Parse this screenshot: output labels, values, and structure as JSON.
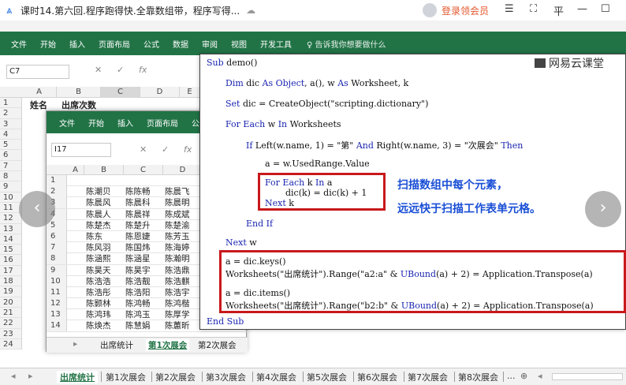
{
  "window": {
    "title": "课时14.第六回.程序跑得快.全靠数组带，程序写得...",
    "vip_label": "登录领会员",
    "ctl_list": "☰",
    "ctl_expand": "⛶",
    "ctl_pin": "平",
    "ctl_min": "—",
    "ctl_max": "☐"
  },
  "ribbon": {
    "tabs": [
      "文件",
      "开始",
      "插入",
      "页面布局",
      "公式",
      "数据",
      "审阅",
      "视图",
      "开发工具"
    ],
    "tell": "♀ 告诉我你想要做什么"
  },
  "outer_sheet": {
    "namebox": "C7",
    "fx": "fx",
    "cols": [
      "A",
      "B",
      "C",
      "D",
      "E"
    ],
    "a1": "姓名",
    "b1": "出席次数",
    "rows": [
      "1",
      "2",
      "3",
      "4",
      "5",
      "6",
      "7",
      "8",
      "9",
      "10",
      "11",
      "12",
      "13",
      "14",
      "15",
      "16",
      "17",
      "18",
      "19",
      "20",
      "21",
      "22",
      "23",
      "24"
    ],
    "tabs": [
      "出席统计",
      "第1次展会",
      "第2次展会",
      "第3次展会",
      "第4次展会",
      "第5次展会",
      "第6次展会",
      "第7次展会",
      "第8次展会",
      "..."
    ]
  },
  "inner_sheet": {
    "ribbon": [
      "文件",
      "开始",
      "插入",
      "页面布局",
      "公"
    ],
    "namebox": "I17",
    "cols": [
      "A",
      "B",
      "C",
      "D"
    ],
    "rows": [
      {
        "n": "1",
        "b": "",
        "c": "",
        "d": ""
      },
      {
        "n": "2",
        "b": "陈潮贝",
        "c": "陈陈畅",
        "d": "陈晨飞"
      },
      {
        "n": "3",
        "b": "陈晨风",
        "c": "陈晨科",
        "d": "陈晨明"
      },
      {
        "n": "4",
        "b": "陈晨人",
        "c": "陈晨祥",
        "d": "陈成斌"
      },
      {
        "n": "5",
        "b": "陈楚杰",
        "c": "陈楚升",
        "d": "陈楚渝"
      },
      {
        "n": "6",
        "b": "陈东",
        "c": "陈恩婕",
        "d": "陈芳玉"
      },
      {
        "n": "7",
        "b": "陈风羽",
        "c": "陈国炜",
        "d": "陈海婷"
      },
      {
        "n": "8",
        "b": "陈涵熙",
        "c": "陈涵星",
        "d": "陈瀚明"
      },
      {
        "n": "9",
        "b": "陈昊天",
        "c": "陈昊宇",
        "d": "陈浩鼎"
      },
      {
        "n": "10",
        "b": "陈浩浩",
        "c": "陈浩靓",
        "d": "陈浩麒"
      },
      {
        "n": "11",
        "b": "陈浩彤",
        "c": "陈浩阳",
        "d": "陈浩宇"
      },
      {
        "n": "12",
        "b": "陈颢林",
        "c": "陈鸿畅",
        "d": "陈鸿楷"
      },
      {
        "n": "13",
        "b": "陈鸿玮",
        "c": "陈鸿玉",
        "d": "陈厚学"
      },
      {
        "n": "14",
        "b": "陈焕杰",
        "c": "陈慧娟",
        "d": "陈蕙昕"
      }
    ],
    "tabs": [
      "出席统计",
      "第1次展会",
      "第2次展会"
    ]
  },
  "code": {
    "l1": "Sub demo()",
    "l2": "Dim dic As Object, a(), w As Worksheet, k",
    "l3": "Set dic = CreateObject(\"scripting.dictionary\")",
    "l4": "For Each w In Worksheets",
    "l5": "If Left(w.name, 1) = \"第\" And Right(w.name, 3) = \"次展会\" Then",
    "l6": "a = w.UsedRange.Value",
    "l7": "For Each k In a",
    "l8": "dic(k) = dic(k) + 1",
    "l9": "Next k",
    "l10": "End If",
    "l11": "Next w",
    "l12": "a = dic.keys()",
    "l13": "Worksheets(\"出席统计\").Range(\"a2:a\" & UBound(a) + 2) = Application.Transpose(a)",
    "l14": "a = dic.items()",
    "l15": "Worksheets(\"出席统计\").Range(\"b2:b\" & UBound(a) + 2) = Application.Transpose(a)",
    "l16": "End Sub"
  },
  "annotation": {
    "line1": "扫描数组中每个元素，",
    "line2": "远远快于扫描工作表单元格。"
  },
  "brand": "网易云课堂",
  "nav": {
    "prev": "‹",
    "next": "›"
  }
}
